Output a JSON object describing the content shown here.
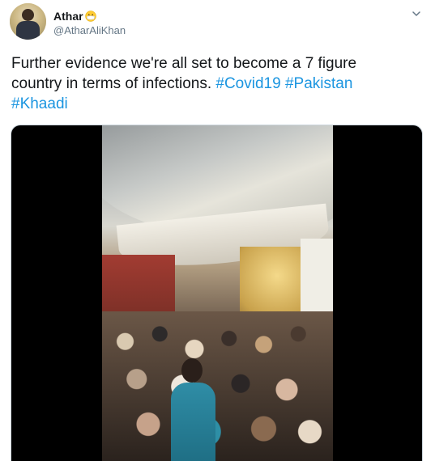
{
  "author": {
    "display_name": "Athar",
    "emoji": "emoji-face-with-medical-mask",
    "handle": "@AtharAliKhan"
  },
  "tweet": {
    "text_line1": "Further evidence we're all set to become a 7 figure",
    "text_line2_plain": "country in terms of infections. ",
    "hashtag1": "#Covid19",
    "space": " ",
    "hashtag2": "#Pakistan",
    "hashtag3": "#Khaadi"
  },
  "colors": {
    "hashtag": "#1b95e0",
    "text": "#14171a",
    "secondary_text": "#657786"
  },
  "media": {
    "type": "video",
    "icon": "video-thumbnail"
  }
}
